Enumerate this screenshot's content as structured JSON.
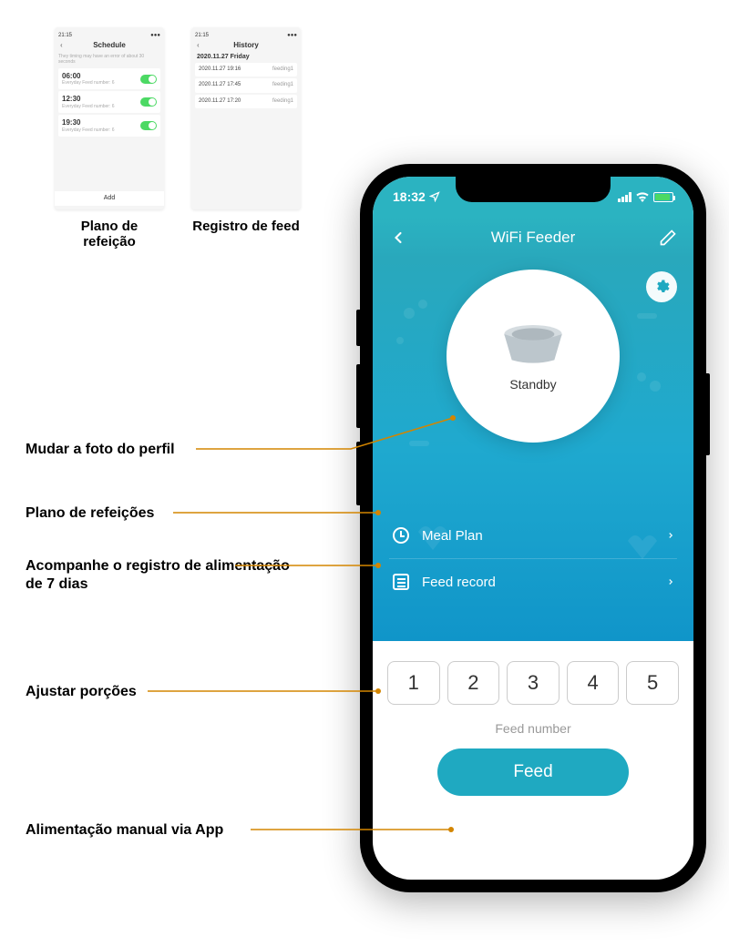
{
  "previews": {
    "mealplan": {
      "title": "Schedule",
      "status_time": "21:15",
      "note": "They timing may have an error of about 30 seconds",
      "rows": [
        {
          "time": "06:00",
          "sub": "Everyday  Feed number: 6"
        },
        {
          "time": "12:30",
          "sub": "Everyday  Feed number: 6"
        },
        {
          "time": "19:30",
          "sub": "Everyday  Feed number: 6"
        }
      ],
      "add": "Add",
      "caption": "Plano de refeição"
    },
    "feedrecord": {
      "title": "History",
      "status_time": "21:15",
      "date": "2020.11.27 Friday",
      "rows": [
        {
          "l": "2020.11.27 19:16",
          "r": "feeding1"
        },
        {
          "l": "2020.11.27 17:45",
          "r": "feeding1"
        },
        {
          "l": "2020.11.27 17:20",
          "r": "feeding1"
        }
      ],
      "caption": "Registro de feed"
    }
  },
  "status": {
    "time": "18:32"
  },
  "header": {
    "title": "WiFi Feeder"
  },
  "hero": {
    "status": "Standby"
  },
  "menu": {
    "meal_plan": "Meal Plan",
    "feed_record": "Feed record"
  },
  "portions": [
    "1",
    "2",
    "3",
    "4",
    "5"
  ],
  "bottom": {
    "label": "Feed number",
    "button": "Feed"
  },
  "callouts": {
    "profile": "Mudar a foto do perfil",
    "plan": "Plano de refeições",
    "record": "Acompanhe o registro de alimentação de 7 dias",
    "portions": "Ajustar porções",
    "feed": "Alimentação manual via App"
  }
}
